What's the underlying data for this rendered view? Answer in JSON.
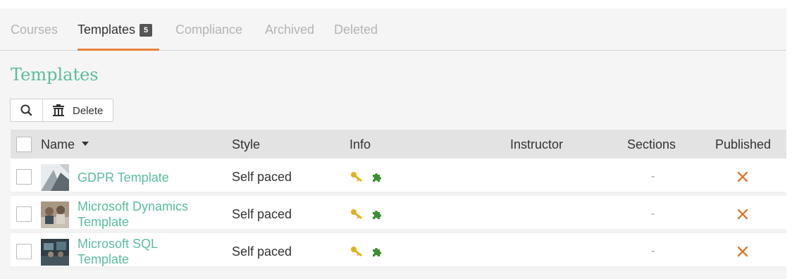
{
  "tabs": [
    {
      "label": "Courses",
      "active": false
    },
    {
      "label": "Templates",
      "active": true,
      "badge": "5"
    },
    {
      "label": "Compliance",
      "active": false
    },
    {
      "label": "Archived",
      "active": false
    },
    {
      "label": "Deleted",
      "active": false
    }
  ],
  "page_title": "Templates",
  "toolbar": {
    "search_icon": "search-icon",
    "delete_icon": "trash-icon",
    "delete_label": "Delete"
  },
  "table": {
    "headers": {
      "name": "Name",
      "style": "Style",
      "info": "Info",
      "instructor": "Instructor",
      "sections": "Sections",
      "published": "Published"
    },
    "sort_icon": "caret-down-icon",
    "rows": [
      {
        "name_line1": "GDPR Template",
        "name_line2": "",
        "style": "Self paced",
        "instructor": "",
        "sections": "-",
        "published": "no"
      },
      {
        "name_line1": "Microsoft Dynamics",
        "name_line2": "Template",
        "style": "Self paced",
        "instructor": "",
        "sections": "-",
        "published": "no"
      },
      {
        "name_line1": "Microsoft SQL",
        "name_line2": "Template",
        "style": "Self paced",
        "instructor": "",
        "sections": "-",
        "published": "no"
      }
    ]
  },
  "icons": {
    "key": "key-icon",
    "puzzle": "puzzle-icon",
    "unpublished": "x-icon"
  },
  "colors": {
    "accent_green": "#5bbd9b",
    "tab_underline": "#e8823a",
    "key_gold": "#e0b21e",
    "puzzle_green": "#3a8f2e",
    "unpublished_x": "#d9792e"
  }
}
